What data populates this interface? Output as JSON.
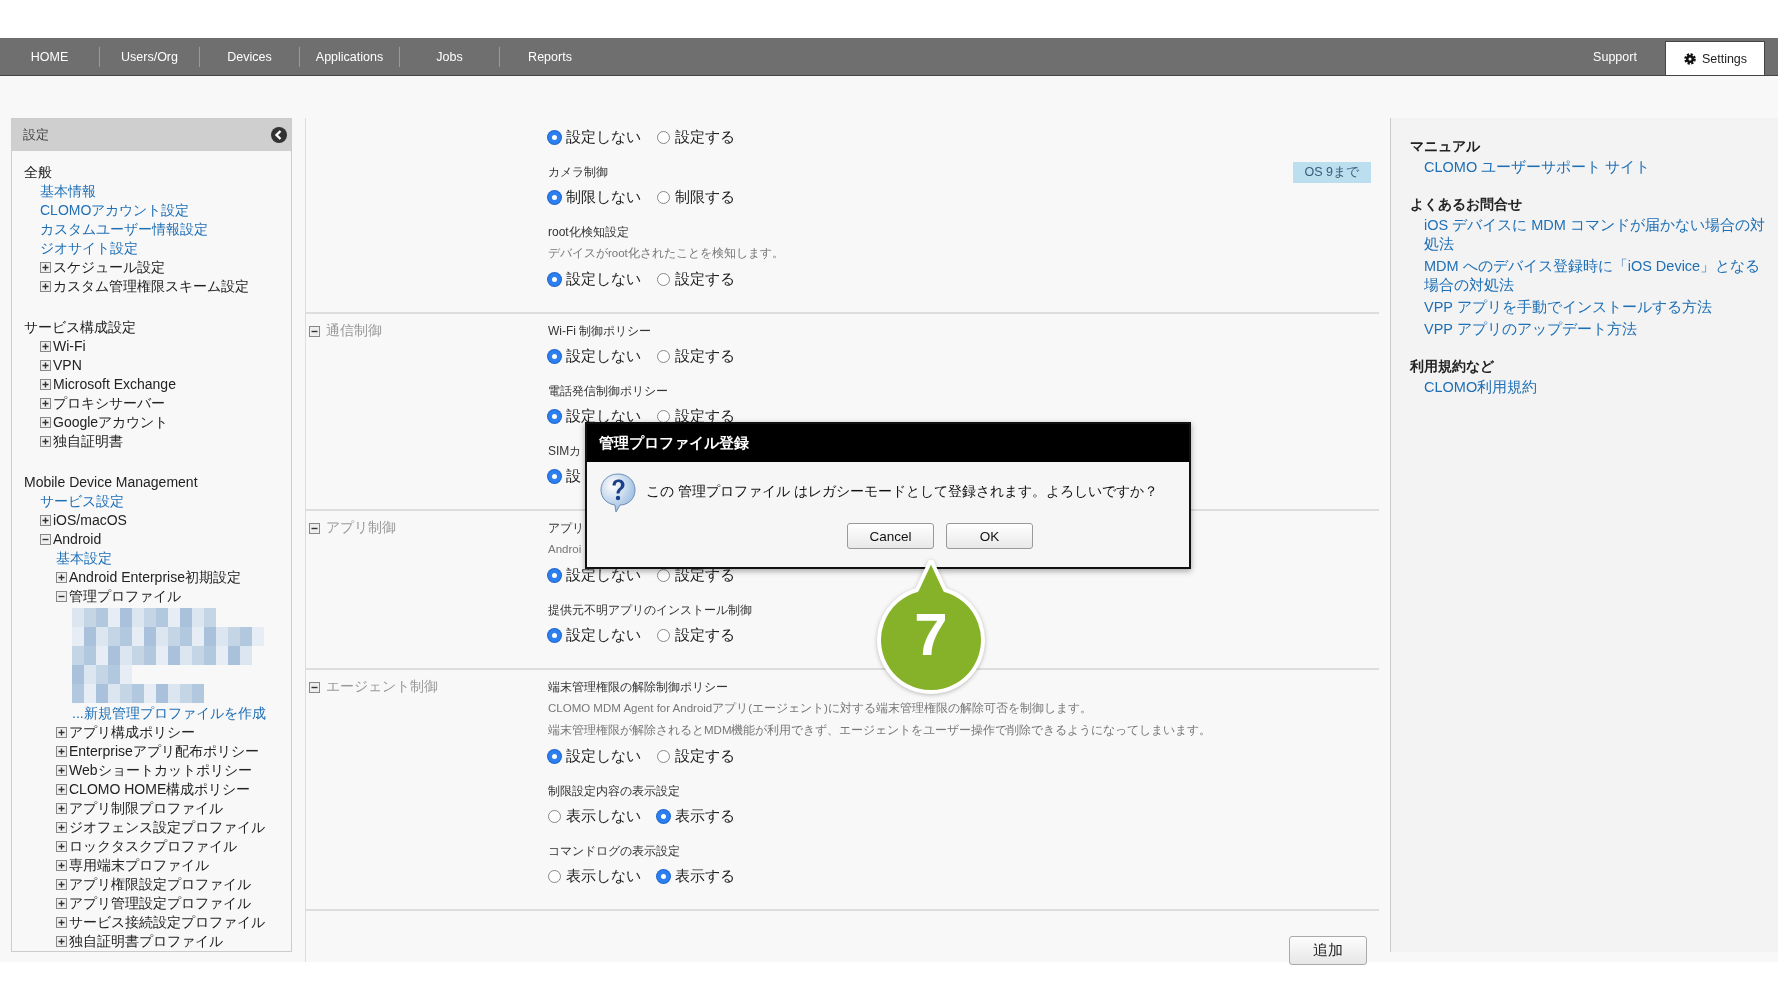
{
  "nav": {
    "left_items": [
      {
        "label": "HOME",
        "selected": false,
        "kind": "tab"
      },
      {
        "label": "Users/Org",
        "selected": false,
        "kind": "tab"
      },
      {
        "label": "Devices",
        "selected": false,
        "kind": "tab"
      },
      {
        "label": "Applications",
        "selected": false,
        "kind": "tab"
      },
      {
        "label": "Jobs",
        "selected": false,
        "kind": "tab"
      },
      {
        "label": "Reports",
        "selected": false,
        "kind": "tab"
      }
    ],
    "right_items": [
      {
        "label": "Support",
        "selected": false,
        "kind": "tab"
      },
      {
        "label": "Settings",
        "selected": true,
        "kind": "gear-tab"
      }
    ]
  },
  "sidebar": {
    "title": "設定",
    "sections": [
      {
        "title": "全般",
        "items": [
          {
            "kind": "link",
            "label": "基本情報"
          },
          {
            "kind": "link",
            "label": "CLOMOアカウント設定"
          },
          {
            "kind": "link",
            "label": "カスタムユーザー情報設定"
          },
          {
            "kind": "link",
            "label": "ジオサイト設定"
          },
          {
            "kind": "node",
            "label": "スケジュール設定",
            "expanded": false
          },
          {
            "kind": "node",
            "label": "カスタム管理権限スキーム設定",
            "expanded": false
          }
        ]
      },
      {
        "title": "サービス構成設定",
        "items": [
          {
            "kind": "node",
            "label": "Wi-Fi",
            "expanded": false
          },
          {
            "kind": "node",
            "label": "VPN",
            "expanded": false
          },
          {
            "kind": "node",
            "label": "Microsoft Exchange",
            "expanded": false
          },
          {
            "kind": "node",
            "label": "プロキシサーバー",
            "expanded": false
          },
          {
            "kind": "node",
            "label": "Googleアカウント",
            "expanded": false
          },
          {
            "kind": "node",
            "label": "独自証明書",
            "expanded": false
          }
        ]
      },
      {
        "title": "Mobile Device Management",
        "items": [
          {
            "kind": "link",
            "label": "サービス設定"
          },
          {
            "kind": "node",
            "label": "iOS/macOS",
            "expanded": false
          },
          {
            "kind": "node",
            "label": "Android",
            "expanded": true,
            "children": [
              {
                "kind": "link",
                "label": "基本設定"
              },
              {
                "kind": "node",
                "label": "Android Enterprise初期設定",
                "expanded": false
              },
              {
                "kind": "node",
                "label": "管理プロファイル",
                "expanded": true,
                "children": [
                  {
                    "kind": "redacted"
                  },
                  {
                    "kind": "link",
                    "label": "...新規管理プロファイルを作成"
                  }
                ]
              },
              {
                "kind": "node",
                "label": "アプリ構成ポリシー",
                "expanded": false
              },
              {
                "kind": "node",
                "label": "Enterpriseアプリ配布ポリシー",
                "expanded": false
              },
              {
                "kind": "node",
                "label": "Webショートカットポリシー",
                "expanded": false
              },
              {
                "kind": "node",
                "label": "CLOMO HOME構成ポリシー",
                "expanded": false
              },
              {
                "kind": "node",
                "label": "アプリ制限プロファイル",
                "expanded": false
              },
              {
                "kind": "node",
                "label": "ジオフェンス設定プロファイル",
                "expanded": false
              },
              {
                "kind": "node",
                "label": "ロックタスクプロファイル",
                "expanded": false
              },
              {
                "kind": "node",
                "label": "専用端末プロファイル",
                "expanded": false
              },
              {
                "kind": "node",
                "label": "アプリ権限設定プロファイル",
                "expanded": false
              },
              {
                "kind": "node",
                "label": "アプリ管理設定プロファイル",
                "expanded": false
              },
              {
                "kind": "node",
                "label": "サービス接続設定プロファイル",
                "expanded": false
              },
              {
                "kind": "node",
                "label": "独自証明書プロファイル",
                "expanded": false
              }
            ]
          }
        ]
      }
    ]
  },
  "main": {
    "sections": [
      {
        "fields": [
          {
            "options": [
              {
                "label": "設定しない",
                "selected": true
              },
              {
                "label": "設定する",
                "selected": false
              }
            ]
          },
          {
            "label": "カメラ制御",
            "badge": "OS 9まで",
            "options": [
              {
                "label": "制限しない",
                "selected": true
              },
              {
                "label": "制限する",
                "selected": false
              }
            ]
          },
          {
            "label": "root化検知設定",
            "description": [
              "デバイスがroot化されたことを検知します。"
            ],
            "options": [
              {
                "label": "設定しない",
                "selected": true
              },
              {
                "label": "設定する",
                "selected": false
              }
            ]
          }
        ]
      },
      {
        "title": "通信制御",
        "expanded": true,
        "fields": [
          {
            "label": "Wi-Fi 制御ポリシー",
            "options": [
              {
                "label": "設定しない",
                "selected": true
              },
              {
                "label": "設定する",
                "selected": false
              }
            ]
          },
          {
            "label": "電話発信制御ポリシー",
            "options": [
              {
                "label": "設定しない",
                "selected": true
              },
              {
                "label": "設定する",
                "selected": false
              }
            ]
          },
          {
            "label": "SIMカ",
            "options": [
              {
                "label": "設",
                "selected": true
              }
            ]
          }
        ]
      },
      {
        "title": "アプリ制御",
        "expanded": true,
        "fields": [
          {
            "label": "アプリ",
            "description": [
              "Androi"
            ],
            "options": [
              {
                "label": "設定しない",
                "selected": true
              },
              {
                "label": "設定する",
                "selected": false
              }
            ]
          },
          {
            "label": "提供元不明アプリのインストール制御",
            "options": [
              {
                "label": "設定しない",
                "selected": true
              },
              {
                "label": "設定する",
                "selected": false
              }
            ]
          }
        ]
      },
      {
        "title": "エージェント制御",
        "expanded": true,
        "fields": [
          {
            "label": "端末管理権限の解除制御ポリシー",
            "description": [
              "CLOMO MDM Agent for Androidアプリ(エージェント)に対する端末管理権限の解除可否を制御します。",
              "端末管理権限が解除されるとMDM機能が利用できず、エージェントをユーザー操作で削除できるようになってしまいます。"
            ],
            "options": [
              {
                "label": "設定しない",
                "selected": true
              },
              {
                "label": "設定する",
                "selected": false
              }
            ]
          },
          {
            "label": "制限設定内容の表示設定",
            "options": [
              {
                "label": "表示しない",
                "selected": false
              },
              {
                "label": "表示する",
                "selected": true
              }
            ]
          },
          {
            "label": "コマンドログの表示設定",
            "options": [
              {
                "label": "表示しない",
                "selected": false
              },
              {
                "label": "表示する",
                "selected": true
              }
            ]
          }
        ]
      }
    ],
    "add_button": "追加"
  },
  "help": {
    "groups": [
      {
        "heading": "マニュアル",
        "links": [
          "CLOMO ユーザーサポート サイト"
        ]
      },
      {
        "heading": "よくあるお問合せ",
        "links": [
          "iOS デバイスに MDM コマンドが届かない場合の対処法",
          "MDM へのデバイス登録時に「iOS Device」となる場合の対処法",
          "VPP アプリを手動でインストールする方法",
          "VPP アプリのアップデート方法"
        ]
      },
      {
        "heading": "利用規約など",
        "links": [
          "CLOMO利用規約"
        ]
      }
    ]
  },
  "dialog": {
    "title": "管理プロファイル登録",
    "message": "この 管理プロファイル はレガシーモードとして登録されます。よろしいですか？",
    "buttons": [
      "Cancel",
      "OK"
    ]
  },
  "callout": {
    "number": "7"
  }
}
